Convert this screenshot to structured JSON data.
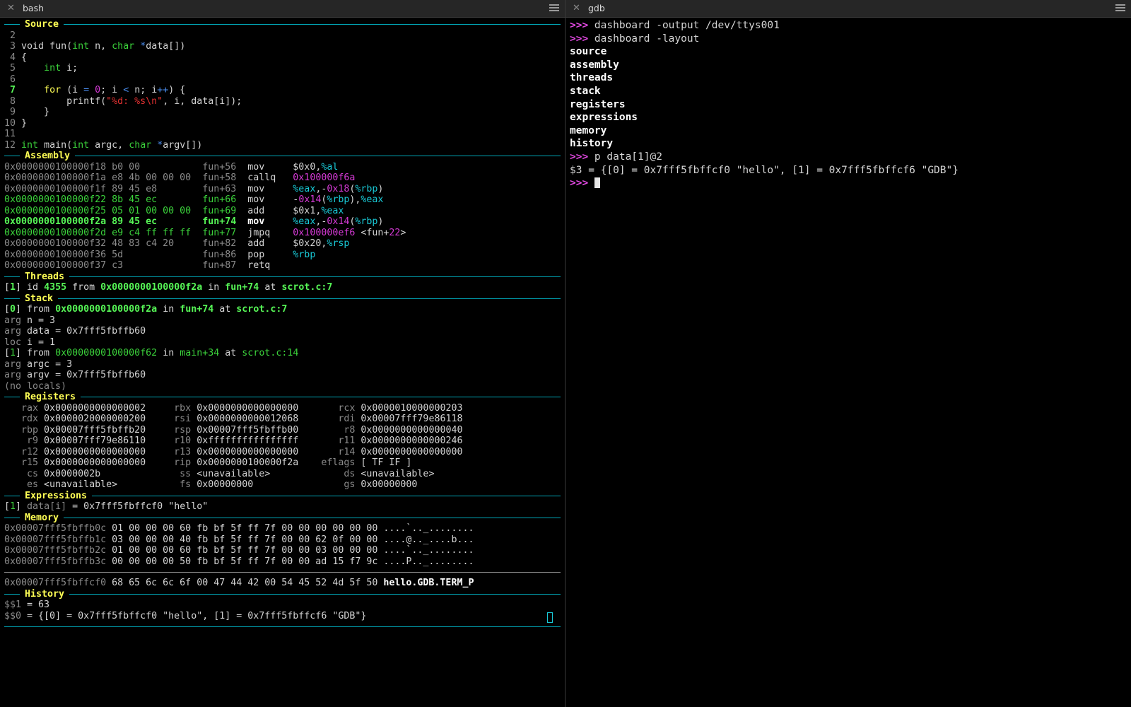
{
  "left_tab": {
    "title": "bash"
  },
  "right_tab": {
    "title": "gdb"
  },
  "sections": {
    "source": "Source",
    "assembly": "Assembly",
    "threads": "Threads",
    "stack": "Stack",
    "registers": "Registers",
    "expressions": "Expressions",
    "memory": "Memory",
    "history": "History"
  },
  "source_lines": [
    {
      "n": " 2",
      "t": [],
      "current": false
    },
    {
      "n": " 3",
      "t": [
        [
          "g",
          ""
        ],
        [
          "",
          "void fun("
        ],
        [
          "gn",
          "int"
        ],
        [
          "",
          " n, "
        ],
        [
          "gn",
          "char"
        ],
        [
          "",
          " "
        ],
        [
          "bl",
          "*"
        ],
        [
          "",
          "data[])"
        ]
      ],
      "current": false
    },
    {
      "n": " 4",
      "t": [
        [
          "",
          "{"
        ]
      ],
      "current": false
    },
    {
      "n": " 5",
      "t": [
        [
          "",
          "    "
        ],
        [
          "gn",
          "int"
        ],
        [
          "",
          " i;"
        ]
      ],
      "current": false
    },
    {
      "n": " 6",
      "t": [],
      "current": false
    },
    {
      "n": " 7",
      "t": [
        [
          "",
          "    "
        ],
        [
          "y",
          "for"
        ],
        [
          "",
          " (i "
        ],
        [
          "bl",
          "="
        ],
        [
          "",
          " "
        ],
        [
          "m2",
          "0"
        ],
        [
          "",
          "; i "
        ],
        [
          "bl",
          "<"
        ],
        [
          "",
          " n; i"
        ],
        [
          "bl",
          "++"
        ],
        [
          "",
          ") {"
        ]
      ],
      "current": true
    },
    {
      "n": " 8",
      "t": [
        [
          "",
          "        printf("
        ],
        [
          "r",
          "\"%d: %s\\n\""
        ],
        [
          "",
          ", i, data[i]);"
        ]
      ],
      "current": false
    },
    {
      "n": " 9",
      "t": [
        [
          "",
          "    }"
        ]
      ],
      "current": false
    },
    {
      "n": "10",
      "t": [
        [
          "",
          "}"
        ]
      ],
      "current": false
    },
    {
      "n": "11",
      "t": [],
      "current": false
    },
    {
      "n": "12",
      "t": [
        [
          "gn",
          "int"
        ],
        [
          "",
          " main("
        ],
        [
          "gn",
          "int"
        ],
        [
          "",
          " argc, "
        ],
        [
          "gn",
          "char"
        ],
        [
          "",
          " "
        ],
        [
          "bl",
          "*"
        ],
        [
          "",
          "argv[])"
        ]
      ],
      "current": false
    }
  ],
  "assembly": [
    {
      "addr": "0x0000000100000f18",
      "bytes": "b0 00",
      "off": "fun+56",
      "op": "mov",
      "args": [
        [
          "",
          "$0x0,"
        ],
        [
          "c",
          "%al"
        ]
      ],
      "hl": false,
      "cur": false
    },
    {
      "addr": "0x0000000100000f1a",
      "bytes": "e8 4b 00 00 00",
      "off": "fun+58",
      "op": "callq",
      "args": [
        [
          "m2",
          "0x100000f6a"
        ]
      ],
      "hl": false,
      "cur": false
    },
    {
      "addr": "0x0000000100000f1f",
      "bytes": "89 45 e8",
      "off": "fun+63",
      "op": "mov",
      "args": [
        [
          "c",
          "%eax"
        ],
        [
          "",
          ",-"
        ],
        [
          "m2",
          "0x18"
        ],
        [
          "",
          "("
        ],
        [
          "c",
          "%rbp"
        ],
        [
          "",
          ")"
        ]
      ],
      "hl": false,
      "cur": false
    },
    {
      "addr": "0x0000000100000f22",
      "bytes": "8b 45 ec",
      "off": "fun+66",
      "op": "mov",
      "args": [
        [
          "",
          "-"
        ],
        [
          "m2",
          "0x14"
        ],
        [
          "",
          "("
        ],
        [
          "c",
          "%rbp"
        ],
        [
          "",
          "),"
        ],
        [
          "c",
          "%eax"
        ]
      ],
      "hl": true,
      "cur": false
    },
    {
      "addr": "0x0000000100000f25",
      "bytes": "05 01 00 00 00",
      "off": "fun+69",
      "op": "add",
      "args": [
        [
          "",
          "$0x1,"
        ],
        [
          "c",
          "%eax"
        ]
      ],
      "hl": true,
      "cur": false
    },
    {
      "addr": "0x0000000100000f2a",
      "bytes": "89 45 ec",
      "off": "fun+74",
      "op": "mov",
      "args": [
        [
          "c",
          "%eax"
        ],
        [
          "",
          ",-"
        ],
        [
          "m2",
          "0x14"
        ],
        [
          "",
          "("
        ],
        [
          "c",
          "%rbp"
        ],
        [
          "",
          ")"
        ]
      ],
      "hl": true,
      "cur": true
    },
    {
      "addr": "0x0000000100000f2d",
      "bytes": "e9 c4 ff ff ff",
      "off": "fun+77",
      "op": "jmpq",
      "args": [
        [
          "m2",
          "0x100000ef6"
        ],
        [
          "",
          " <fun+"
        ],
        [
          "m2",
          "22"
        ],
        [
          "",
          ">"
        ]
      ],
      "hl": true,
      "cur": false
    },
    {
      "addr": "0x0000000100000f32",
      "bytes": "48 83 c4 20",
      "off": "fun+82",
      "op": "add",
      "args": [
        [
          "",
          "$0x20,"
        ],
        [
          "c",
          "%rsp"
        ]
      ],
      "hl": false,
      "cur": false
    },
    {
      "addr": "0x0000000100000f36",
      "bytes": "5d",
      "off": "fun+86",
      "op": "pop",
      "args": [
        [
          "c",
          "%rbp"
        ]
      ],
      "hl": false,
      "cur": false
    },
    {
      "addr": "0x0000000100000f37",
      "bytes": "c3",
      "off": "fun+87",
      "op": "retq",
      "args": [],
      "hl": false,
      "cur": false
    }
  ],
  "threads": [
    [
      [
        "",
        "["
      ],
      [
        "gb",
        "1"
      ],
      [
        "",
        "] id "
      ],
      [
        "gb",
        "4355"
      ],
      [
        "",
        " from "
      ],
      [
        "gb",
        "0x0000000100000f2a"
      ],
      [
        "",
        " in "
      ],
      [
        "gb",
        "fun+74"
      ],
      [
        "",
        " at "
      ],
      [
        "gb",
        "scrot.c:7"
      ]
    ]
  ],
  "stack": [
    [
      [
        "",
        "["
      ],
      [
        "gb",
        "0"
      ],
      [
        "",
        "] from "
      ],
      [
        "gb",
        "0x0000000100000f2a"
      ],
      [
        "",
        " in "
      ],
      [
        "gb",
        "fun+74"
      ],
      [
        "",
        " at "
      ],
      [
        "gb",
        "scrot.c:7"
      ]
    ],
    [
      [
        "g",
        "arg"
      ],
      [
        "",
        " n = 3"
      ]
    ],
    [
      [
        "g",
        "arg"
      ],
      [
        "",
        " data = 0x7fff5fbffb60"
      ]
    ],
    [
      [
        "g",
        "loc"
      ],
      [
        "",
        " i = 1"
      ]
    ],
    [
      [
        "",
        "["
      ],
      [
        "gn",
        "1"
      ],
      [
        "",
        "] from "
      ],
      [
        "gn",
        "0x0000000100000f62"
      ],
      [
        "",
        " in "
      ],
      [
        "gn",
        "main+34"
      ],
      [
        "",
        " at "
      ],
      [
        "gn",
        "scrot.c:14"
      ]
    ],
    [
      [
        "g",
        "arg"
      ],
      [
        "",
        " argc = 3"
      ]
    ],
    [
      [
        "g",
        "arg"
      ],
      [
        "",
        " argv = 0x7fff5fbffb60"
      ]
    ],
    [
      [
        "g",
        "(no locals)"
      ]
    ]
  ],
  "registers": [
    [
      [
        "rax",
        "0x0000000000000002"
      ],
      [
        "rbx",
        "0x0000000000000000"
      ],
      [
        "rcx",
        "0x0000010000000203"
      ]
    ],
    [
      [
        "rdx",
        "0x0000020000000200"
      ],
      [
        "rsi",
        "0x0000000000012068"
      ],
      [
        "rdi",
        "0x00007fff79e86118"
      ]
    ],
    [
      [
        "rbp",
        "0x00007fff5fbffb20"
      ],
      [
        "rsp",
        "0x00007fff5fbffb00"
      ],
      [
        "r8",
        "0x0000000000000040"
      ]
    ],
    [
      [
        "r9",
        "0x00007fff79e86110"
      ],
      [
        "r10",
        "0xffffffffffffffff"
      ],
      [
        "r11",
        "0x0000000000000246"
      ]
    ],
    [
      [
        "r12",
        "0x0000000000000000"
      ],
      [
        "r13",
        "0x0000000000000000"
      ],
      [
        "r14",
        "0x0000000000000000"
      ]
    ],
    [
      [
        "r15",
        "0x0000000000000000"
      ],
      [
        "rip",
        "0x0000000100000f2a"
      ],
      [
        "eflags",
        "[ TF IF ]"
      ]
    ],
    [
      [
        "cs",
        "0x0000002b"
      ],
      [
        "ss",
        "<unavailable>"
      ],
      [
        "ds",
        "<unavailable>"
      ]
    ],
    [
      [
        "es",
        "<unavailable>"
      ],
      [
        "fs",
        "0x00000000"
      ],
      [
        "gs",
        "0x00000000"
      ]
    ]
  ],
  "expressions": [
    [
      [
        "",
        "["
      ],
      [
        "gn",
        "1"
      ],
      [
        "",
        "] "
      ],
      [
        "g",
        "data[i]"
      ],
      [
        "",
        " = 0x7fff5fbffcf0 \"hello\""
      ]
    ]
  ],
  "memory_block1": [
    {
      "addr": "0x00007fff5fbffb0c",
      "hex": "01 00 00 00 60 fb bf 5f ff 7f 00 00 00 00 00 00",
      "ascii": "....`.._........"
    },
    {
      "addr": "0x00007fff5fbffb1c",
      "hex": "03 00 00 00 40 fb bf 5f ff 7f 00 00 62 0f 00 00",
      "ascii": "....@.._....b..."
    },
    {
      "addr": "0x00007fff5fbffb2c",
      "hex": "01 00 00 00 60 fb bf 5f ff 7f 00 00 03 00 00 00",
      "ascii": "....`.._........"
    },
    {
      "addr": "0x00007fff5fbffb3c",
      "hex": "00 00 00 00 50 fb bf 5f ff 7f 00 00 ad 15 f7 9c",
      "ascii": "....P.._........"
    }
  ],
  "memory_block2": [
    {
      "addr": "0x00007fff5fbffcf0",
      "hex": "68 65 6c 6c 6f 00 47 44 42 00 54 45 52 4d 5f 50",
      "ascii": "hello.GDB.TERM_P"
    }
  ],
  "history": [
    [
      [
        "g",
        "$$1"
      ],
      [
        "",
        " = 63"
      ]
    ],
    [
      [
        "g",
        "$$0"
      ],
      [
        "",
        " = {[0] = 0x7fff5fbffcf0 \"hello\", [1] = 0x7fff5fbffcf6 \"GDB\"}"
      ]
    ]
  ],
  "gdb_console": [
    {
      "prompt": ">>> ",
      "cmd": "dashboard -output /dev/ttys001"
    },
    {
      "prompt": ">>> ",
      "cmd": "dashboard -layout"
    },
    {
      "out": "source"
    },
    {
      "out": "assembly"
    },
    {
      "out": "threads"
    },
    {
      "out": "stack"
    },
    {
      "out": "registers"
    },
    {
      "out": "expressions"
    },
    {
      "out": "memory"
    },
    {
      "out": "history"
    },
    {
      "prompt": ">>> ",
      "cmd": "p data[1]@2"
    },
    {
      "plain": "$3 = {[0] = 0x7fff5fbffcf0 \"hello\", [1] = 0x7fff5fbffcf6 \"GDB\"}"
    },
    {
      "prompt": ">>> ",
      "cmd": "",
      "cursor": true
    }
  ]
}
